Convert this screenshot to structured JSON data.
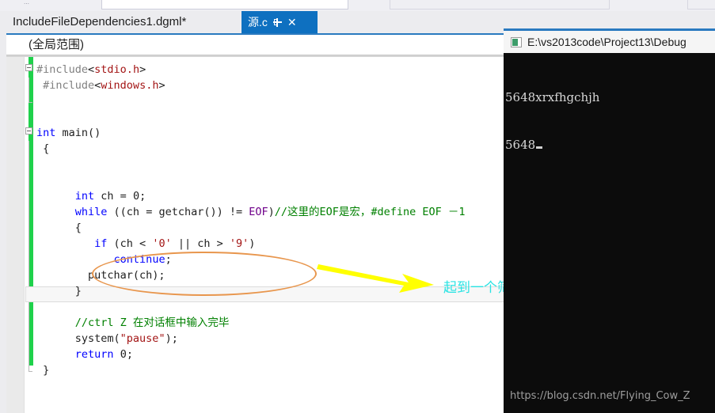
{
  "toolbar": {
    "dots_label": "⋯"
  },
  "tabs": {
    "inactive_label": "IncludeFileDependencies1.dgml*",
    "active_label": "源.c",
    "pin_icon": "pin-icon",
    "close_icon": "✕"
  },
  "editor": {
    "scope_label": "(全局范围)",
    "code_lines": [
      {
        "indent": 0,
        "fold": "open",
        "segments": [
          {
            "t": "#include",
            "c": "pre"
          },
          {
            "t": "<",
            "c": "pl"
          },
          {
            "t": "stdio.h",
            "c": "str"
          },
          {
            "t": ">",
            "c": "pl"
          }
        ]
      },
      {
        "indent": 0,
        "fold": "bar",
        "segments": [
          {
            "t": " #include",
            "c": "pre"
          },
          {
            "t": "<",
            "c": "pl"
          },
          {
            "t": "windows.h",
            "c": "str"
          },
          {
            "t": ">",
            "c": "pl"
          }
        ]
      },
      {
        "indent": 0,
        "fold": "endbar",
        "segments": [
          {
            "t": "",
            "c": "pl"
          }
        ]
      },
      {
        "indent": 0,
        "fold": "none",
        "segments": [
          {
            "t": "",
            "c": "pl"
          }
        ]
      },
      {
        "indent": 0,
        "fold": "open",
        "segments": [
          {
            "t": "int",
            "c": "kw"
          },
          {
            "t": " main()",
            "c": "pl"
          }
        ]
      },
      {
        "indent": 0,
        "fold": "bar",
        "segments": [
          {
            "t": " {",
            "c": "pl"
          }
        ]
      },
      {
        "indent": 0,
        "fold": "bar",
        "segments": [
          {
            "t": "",
            "c": "pl"
          }
        ]
      },
      {
        "indent": 0,
        "fold": "bar",
        "segments": [
          {
            "t": " ",
            "c": "pl"
          }
        ]
      },
      {
        "indent": 0,
        "fold": "bar",
        "segments": [
          {
            "t": "      ",
            "c": "pl"
          },
          {
            "t": "int",
            "c": "kw"
          },
          {
            "t": " ch = 0;",
            "c": "pl"
          }
        ]
      },
      {
        "indent": 0,
        "fold": "bar",
        "segments": [
          {
            "t": "      ",
            "c": "pl"
          },
          {
            "t": "while",
            "c": "kw"
          },
          {
            "t": " ((ch = getchar()) != ",
            "c": "pl"
          },
          {
            "t": "EOF",
            "c": "mac"
          },
          {
            "t": ")",
            "c": "pl"
          },
          {
            "t": "//这里的EOF是宏，#define EOF －1",
            "c": "cm"
          }
        ]
      },
      {
        "indent": 0,
        "fold": "bar",
        "segments": [
          {
            "t": "      {",
            "c": "pl"
          }
        ]
      },
      {
        "indent": 0,
        "fold": "bar",
        "segments": [
          {
            "t": "         ",
            "c": "pl"
          },
          {
            "t": "if",
            "c": "kw"
          },
          {
            "t": " (ch < ",
            "c": "pl"
          },
          {
            "t": "'0'",
            "c": "str"
          },
          {
            "t": " || ch > ",
            "c": "pl"
          },
          {
            "t": "'9'",
            "c": "str"
          },
          {
            "t": ")",
            "c": "pl"
          }
        ]
      },
      {
        "indent": 0,
        "fold": "bar",
        "segments": [
          {
            "t": "            ",
            "c": "pl"
          },
          {
            "t": "continue",
            "c": "kw"
          },
          {
            "t": ";",
            "c": "pl"
          }
        ]
      },
      {
        "indent": 0,
        "fold": "bar",
        "segments": [
          {
            "t": "        putchar(ch);",
            "c": "pl"
          }
        ]
      },
      {
        "indent": 0,
        "fold": "bar",
        "segments": [
          {
            "t": "      }",
            "c": "pl"
          }
        ]
      },
      {
        "indent": 0,
        "fold": "bar",
        "segments": [
          {
            "t": "",
            "c": "pl"
          }
        ]
      },
      {
        "indent": 0,
        "fold": "bar",
        "segments": [
          {
            "t": "      ",
            "c": "pl"
          },
          {
            "t": "//ctrl Z 在对话框中输入完毕",
            "c": "cm"
          }
        ]
      },
      {
        "indent": 0,
        "fold": "bar",
        "segments": [
          {
            "t": "      system(",
            "c": "pl"
          },
          {
            "t": "\"pause\"",
            "c": "str"
          },
          {
            "t": ");",
            "c": "pl"
          }
        ]
      },
      {
        "indent": 0,
        "fold": "bar",
        "segments": [
          {
            "t": "      ",
            "c": "pl"
          },
          {
            "t": "return",
            "c": "kw"
          },
          {
            "t": " 0;",
            "c": "pl"
          }
        ]
      },
      {
        "indent": 0,
        "fold": "endbar",
        "segments": [
          {
            "t": " }",
            "c": "pl"
          }
        ]
      }
    ],
    "annotation_text": "起到一个筛选作用",
    "annotation_color": "#29e3e3",
    "ellipse_color": "#e8964d",
    "arrow_color": "#ffff00",
    "changebar_color": "#1fd14b"
  },
  "console": {
    "title": "E:\\vs2013code\\Project13\\Debug",
    "output_lines": [
      "5648xrxfhgchjh",
      "5648"
    ],
    "watermark": "https://blog.csdn.net/Flying_Cow_Z"
  }
}
